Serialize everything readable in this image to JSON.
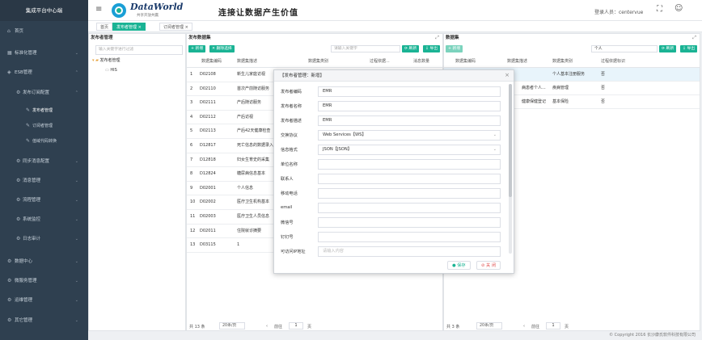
{
  "sidebar": {
    "title": "集成平台中心端",
    "items": [
      {
        "icon": "home-icon",
        "label": "首页",
        "chevron": ""
      },
      {
        "icon": "standard-icon",
        "label": "标准化管理",
        "chevron": "⌄"
      },
      {
        "icon": "esb-icon",
        "label": "ESB管理",
        "chevron": "⌃"
      },
      {
        "icon": "gear-icon",
        "label": "发布订阅配置",
        "chevron": "⌃"
      },
      {
        "icon": "wrench-icon",
        "label": "发布者管理",
        "chevron": ""
      },
      {
        "icon": "wrench-icon",
        "label": "订阅者管理",
        "chevron": ""
      },
      {
        "icon": "wrench-icon",
        "label": "值域代码转换",
        "chevron": ""
      },
      {
        "icon": "gear-icon",
        "label": "同步消息配置",
        "chevron": "⌄"
      },
      {
        "icon": "gear-icon",
        "label": "消息管理",
        "chevron": "⌄"
      },
      {
        "icon": "gear-icon",
        "label": "流程管理",
        "chevron": "⌄"
      },
      {
        "icon": "gear-icon",
        "label": "系统监控",
        "chevron": "⌄"
      },
      {
        "icon": "gear-icon",
        "label": "日志审计",
        "chevron": "⌄"
      },
      {
        "icon": "gear-icon",
        "label": "数据中心",
        "chevron": "⌄"
      },
      {
        "icon": "gear-icon",
        "label": "微服务管理",
        "chevron": "⌄"
      },
      {
        "icon": "gear-icon",
        "label": "运维管理",
        "chevron": "⌄"
      },
      {
        "icon": "gear-icon",
        "label": "其它管理",
        "chevron": "⌄"
      }
    ]
  },
  "header": {
    "logo_text": "DataWorld",
    "logo_sub": "共享开放共赢",
    "slogan": "连接让数据产生价值",
    "login_label": "登录人员：centervue"
  },
  "tabs": [
    {
      "label": "首页"
    },
    {
      "label": "发布者管理 ×"
    },
    {
      "label": "订阅者管理 ×"
    }
  ],
  "left_panel": {
    "title": "发布者管理",
    "search_placeholder": "输入关键字进行过滤",
    "root": "发布者管理",
    "child": "HIS"
  },
  "mid_panel": {
    "title": "发布数据集",
    "add_label": "+ 新增",
    "del_label": "✕ 删除选择",
    "search_placeholder": "请输入关键字",
    "refresh_label": "⟳ 刷新",
    "export_label": "⇩ 导出",
    "columns": [
      "数据集编码",
      "数据集描述",
      "数据集类别",
      "过程依据...",
      "消息数量"
    ],
    "rows": [
      {
        "n": "1",
        "code": "D02108",
        "desc": "新生儿家庭访视"
      },
      {
        "n": "2",
        "code": "D02110",
        "desc": "首次产前随访服务"
      },
      {
        "n": "3",
        "code": "D02111",
        "desc": "产后随访服务"
      },
      {
        "n": "4",
        "code": "D02112",
        "desc": "产后访视"
      },
      {
        "n": "5",
        "code": "D02113",
        "desc": "产后42天健康检查"
      },
      {
        "n": "6",
        "code": "D12817",
        "desc": "死亡信息的数据录入"
      },
      {
        "n": "7",
        "code": "D12818",
        "desc": "妇女生育史的采集"
      },
      {
        "n": "8",
        "code": "D12824",
        "desc": "糖尿病信息基本"
      },
      {
        "n": "9",
        "code": "D02001",
        "desc": "个人信息"
      },
      {
        "n": "10",
        "code": "D02002",
        "desc": "医疗卫生机构基本"
      },
      {
        "n": "11",
        "code": "D02003",
        "desc": "医疗卫生人员信息"
      },
      {
        "n": "12",
        "code": "D02011",
        "desc": "住院就诊摘要"
      },
      {
        "n": "13",
        "code": "D03115",
        "desc": "1"
      }
    ],
    "total": "共 13 条",
    "page_size": "20条/页",
    "goto": "前往",
    "page": "1",
    "page_suffix": "页"
  },
  "right_panel": {
    "title": "数据集",
    "add_label": "+ 新增",
    "search_value": "个人",
    "refresh_label": "⟳ 刷新",
    "export_label": "⇩ 导出",
    "columns": [
      "数据集编码",
      "数据集描述",
      "数据集类别",
      "过程依据标识"
    ],
    "rows": [
      {
        "code": "",
        "desc": "",
        "cat": "个人基本注册服务",
        "flag": "否"
      },
      {
        "code": "",
        "desc": "病患者个人...",
        "cat": "疾病管理",
        "flag": "否"
      },
      {
        "code": "",
        "desc": "健康保健登记",
        "cat": "基本保险",
        "flag": "否"
      }
    ],
    "total": "共 3 条",
    "page_size": "20条/页",
    "goto": "前往",
    "page": "1",
    "page_suffix": "页"
  },
  "modal": {
    "title": "【发布者管理：新增】",
    "fields": [
      {
        "label": "发布者编码",
        "value": "EMR",
        "type": "text"
      },
      {
        "label": "发布者名称",
        "value": "EMR",
        "type": "text"
      },
      {
        "label": "发布者描述",
        "value": "EMR",
        "type": "text"
      },
      {
        "label": "交换协议",
        "value": "Web Services【WS】",
        "type": "select"
      },
      {
        "label": "信息格式",
        "value": "JSON【JSON】",
        "type": "select"
      },
      {
        "label": "单位名称",
        "value": "",
        "type": "text"
      },
      {
        "label": "联系人",
        "value": "",
        "type": "text"
      },
      {
        "label": "移动电话",
        "value": "",
        "type": "text"
      },
      {
        "label": "email",
        "value": "",
        "type": "text"
      },
      {
        "label": "微信号",
        "value": "",
        "type": "text"
      },
      {
        "label": "钉钉号",
        "value": "",
        "type": "text"
      },
      {
        "label": "可访问IP地址",
        "value": "",
        "placeholder": "请输入内容",
        "type": "text"
      }
    ],
    "save_label": "● 保存",
    "close_label": "⊘ 关 闭"
  },
  "footer": "© Copyright 2016 长沙康氏软件科技有限公司",
  "colors": {
    "sidebar": "#2f4050",
    "accent": "#1ab394"
  }
}
